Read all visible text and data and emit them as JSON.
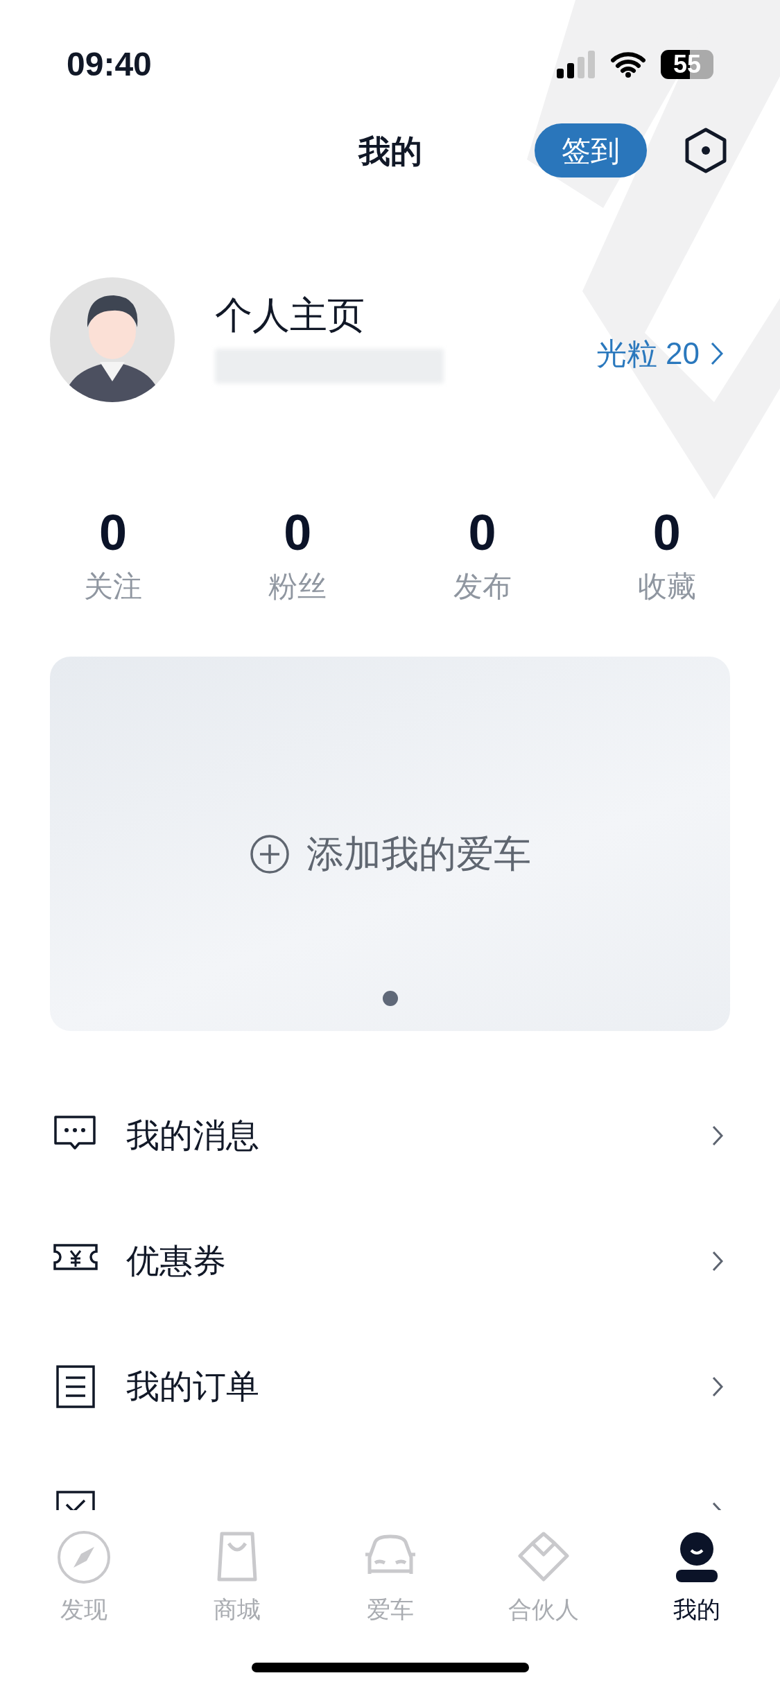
{
  "status_bar": {
    "time": "09:40",
    "battery": "55"
  },
  "header": {
    "title": "我的",
    "checkin_button": "签到"
  },
  "profile": {
    "name": "个人主页",
    "points_link": "光粒 20"
  },
  "stats": [
    {
      "value": "0",
      "label": "关注"
    },
    {
      "value": "0",
      "label": "粉丝"
    },
    {
      "value": "0",
      "label": "发布"
    },
    {
      "value": "0",
      "label": "收藏"
    }
  ],
  "car_card": {
    "add_label": "添加我的爱车",
    "page_dots": [
      {
        "selected": true
      }
    ]
  },
  "menu": [
    {
      "kind": "message",
      "label": "我的消息"
    },
    {
      "kind": "coupon",
      "label": "优惠券"
    },
    {
      "kind": "order",
      "label": "我的订单"
    },
    {
      "kind": "event"
    }
  ],
  "tab_bar": [
    {
      "kind": "discover",
      "label": "发现",
      "selected": false
    },
    {
      "kind": "shop",
      "label": "商城",
      "selected": false
    },
    {
      "kind": "car",
      "label": "爱车",
      "selected": false
    },
    {
      "kind": "partner",
      "label": "合伙人",
      "selected": false
    },
    {
      "kind": "me",
      "label": "我的",
      "selected": true
    }
  ]
}
